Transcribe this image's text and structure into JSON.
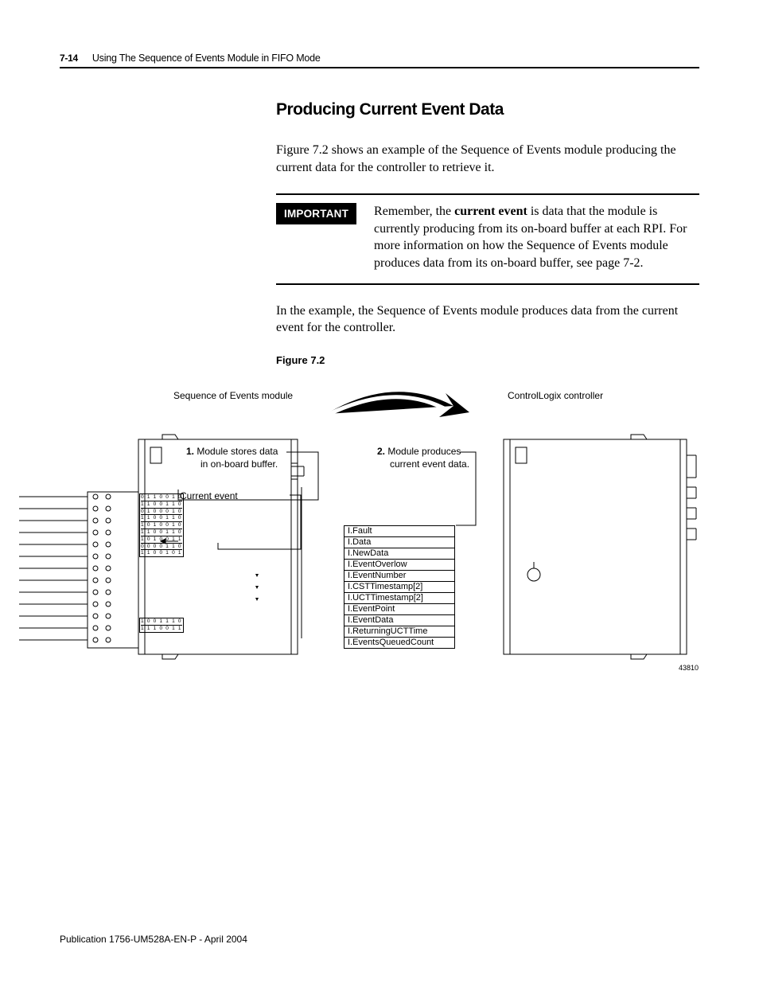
{
  "header": {
    "page_num": "7-14",
    "chapter": "Using The Sequence of Events Module in FIFO Mode"
  },
  "section": {
    "title": "Producing Current Event Data",
    "intro": "Figure 7.2 shows an example of the Sequence of Events module producing the current data for the controller to retrieve it.",
    "important_label": "IMPORTANT",
    "important_prefix": "Remember, the ",
    "important_bold": "current event",
    "important_rest": " is data that the module is currently producing from its on-board buffer at each RPI. For more information on how the Sequence of Events module produces data from its on-board buffer, see page 7-2.",
    "post_important": "In the example, the Sequence of Events module produces data from the current event for the controller.",
    "figure_caption": "Figure 7.2"
  },
  "figure": {
    "left_module_label": "Sequence of Events module",
    "right_module_label": "ControlLogix controller",
    "step1_num": "1.",
    "step1_text_l1": "Module stores data",
    "step1_text_l2": "in on-board buffer.",
    "step2_num": "2.",
    "step2_text_l1": "Module produces",
    "step2_text_l2": "current event data.",
    "current_event_label": "Current event",
    "buffer_top": [
      "0 1 1 0 0 1 0",
      "1 1 0 0 1 1 0",
      "0 1 0 0 0 1 0",
      "1 1 0 0 1 1 0",
      "1 0 1 0 0 1 0",
      "1 1 0 0 1 1 0",
      "1 0 1 0 0 1 1",
      "0 0 0 0 1 1 0",
      "1 1 0 0 1 0 1"
    ],
    "buffer_bottom": [
      "1 0 0 1 1 1 0",
      "1 1 1 0 0 1 1"
    ],
    "tags": [
      "I.Fault",
      "I.Data",
      "I.NewData",
      "I.EventOverlow",
      "I.EventNumber",
      "I.CSTTimestamp[2]",
      "I.UCTTimestamp[2]",
      "I.EventPoint",
      "I.EventData",
      "I.ReturningUCTTime",
      "I.EventsQueuedCount"
    ],
    "figid": "43810"
  },
  "footer": "Publication 1756-UM528A-EN-P - April 2004"
}
